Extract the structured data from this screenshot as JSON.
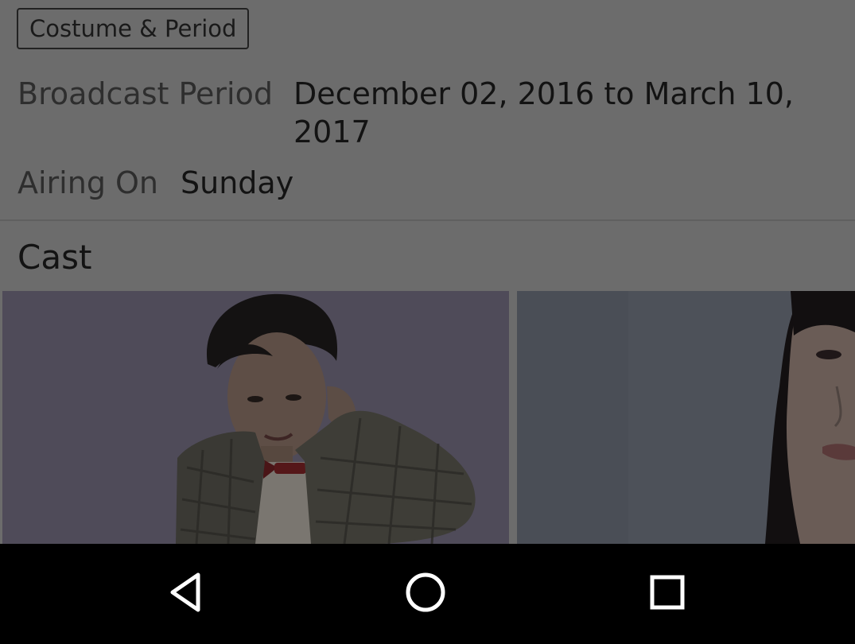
{
  "details": {
    "genre_tag": "Costume & Period",
    "broadcast_label": "Broadcast Period",
    "broadcast_value": "December 02, 2016 to March 10, 2017",
    "airing_label": "Airing On",
    "airing_value": "Sunday"
  },
  "cast": {
    "title": "Cast",
    "items": [
      {
        "photo": "cast-photo-male-actor"
      },
      {
        "photo": "cast-photo-female-actor"
      }
    ]
  },
  "navbar": {
    "back_icon": "back-triangle-icon",
    "home_icon": "home-circle-icon",
    "recents_icon": "recents-square-icon"
  },
  "colors": {
    "dim_overlay_background": "#6c6c6c",
    "navbar_background": "#000000",
    "nav_icon": "#ffffff"
  }
}
